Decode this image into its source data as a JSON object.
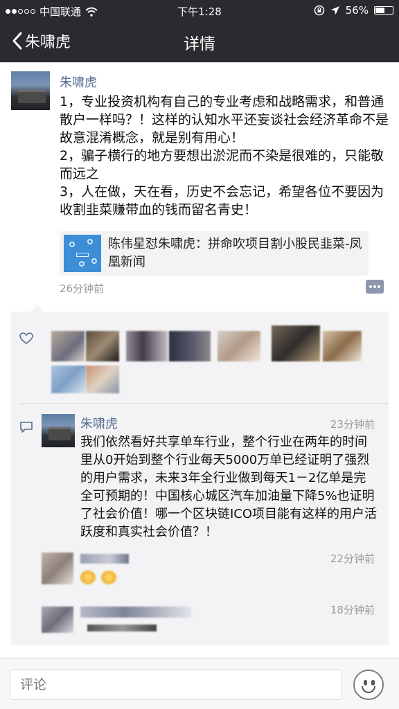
{
  "status": {
    "carrier": "中国联通",
    "time": "下午1:28",
    "battery_percent": "56%",
    "battery_level": 0.56
  },
  "nav": {
    "back_label": "朱啸虎",
    "title": "详情"
  },
  "post": {
    "author": "朱啸虎",
    "paragraphs": [
      "1，专业投资机构有自己的专业考虑和战略需求，和普通散户一样吗？！这样的认知水平还妄谈社会经济革命不是故意混淆概念，就是别有用心！",
      "2，骗子横行的地方要想出淤泥而不染是很难的，只能敬而远之",
      "3，人在做，天在看，历史不会忘记，希望各位不要因为收割韭菜赚带血的钱而留名青史！"
    ],
    "shared_link": "陈伟星怼朱啸虎：拼命吹项目割小股民韭菜-凤凰新闻",
    "time": "26分钟前"
  },
  "comments": [
    {
      "author": "朱啸虎",
      "time": "23分钟前",
      "text": "我们依然看好共享单车行业，整个行业在两年的时间里从0开始到整个行业每天5000万单已经证明了强烈的用户需求，未来3年全行业做到每天1－2亿单是完全可预期的！中国核心城区汽车加油量下降5%也证明了社会价值！哪一个区块链ICO项目能有这样的用户活跃度和真实社会价值？！"
    },
    {
      "time": "22分钟前"
    },
    {
      "time": "18分钟前"
    }
  ],
  "input": {
    "placeholder": "评论"
  },
  "icons": {
    "back": "chevron-left-icon",
    "wifi": "wifi-icon",
    "lock_rotation": "rotation-lock-icon",
    "location": "location-arrow-icon",
    "like": "heart-icon",
    "comment": "comment-icon",
    "emoji": "smiley-icon"
  },
  "colors": {
    "bar_bg": "#2b2a2f",
    "name_link": "#576b95",
    "meta_gray": "#9a9a9a",
    "interaction_bg": "#f3f3f5"
  }
}
